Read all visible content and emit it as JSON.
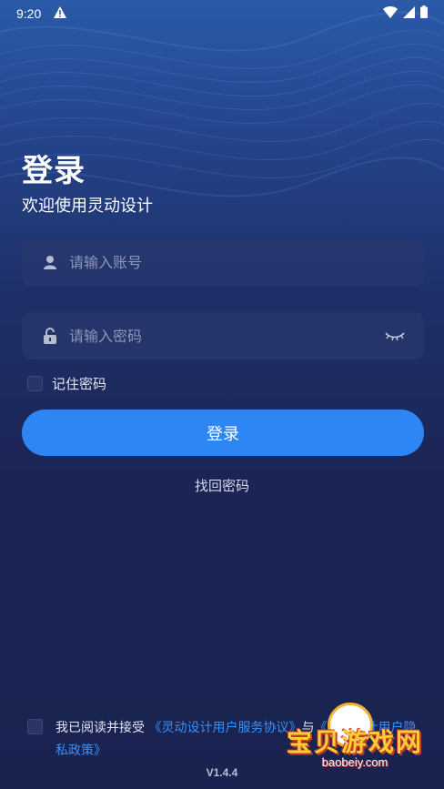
{
  "status_bar": {
    "time": "9:20",
    "icons": [
      "warning-icon",
      "wifi-icon",
      "signal-icon",
      "battery-icon"
    ]
  },
  "header": {
    "title": "登录",
    "subtitle": "欢迎使用灵动设计"
  },
  "form": {
    "username_placeholder": "请输入账号",
    "password_placeholder": "请输入密码",
    "remember_label": "记住密码",
    "remember_checked": false,
    "login_label": "登录",
    "forgot_label": "找回密码"
  },
  "agreement": {
    "prefix": "我已阅读并接受",
    "service_link": "《灵动设计用户服务协议》",
    "joiner": "与",
    "privacy_link": "《灵动设计用户隐私政策》",
    "checked": false
  },
  "version": "V1.4.4",
  "watermark": {
    "text": "宝贝游戏网",
    "url": "baobeiy.com"
  },
  "colors": {
    "accent": "#2e86f5",
    "link": "#3a8ff5",
    "background": "#1a2350",
    "field": "#28376e"
  }
}
